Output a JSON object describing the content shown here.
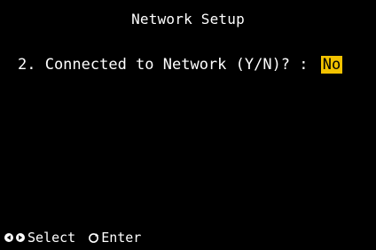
{
  "screen": {
    "title": "Network Setup",
    "prompt": "2. Connected to Network (Y/N)? :",
    "selected_value": "No"
  },
  "footer": {
    "select_label": "Select",
    "enter_label": "Enter",
    "icons": {
      "left": "arrow-left-circle-icon",
      "right": "arrow-right-circle-icon",
      "enter": "enter-circle-icon"
    }
  },
  "colors": {
    "background": "#000000",
    "text": "#ffffff",
    "highlight": "#f2c200"
  }
}
